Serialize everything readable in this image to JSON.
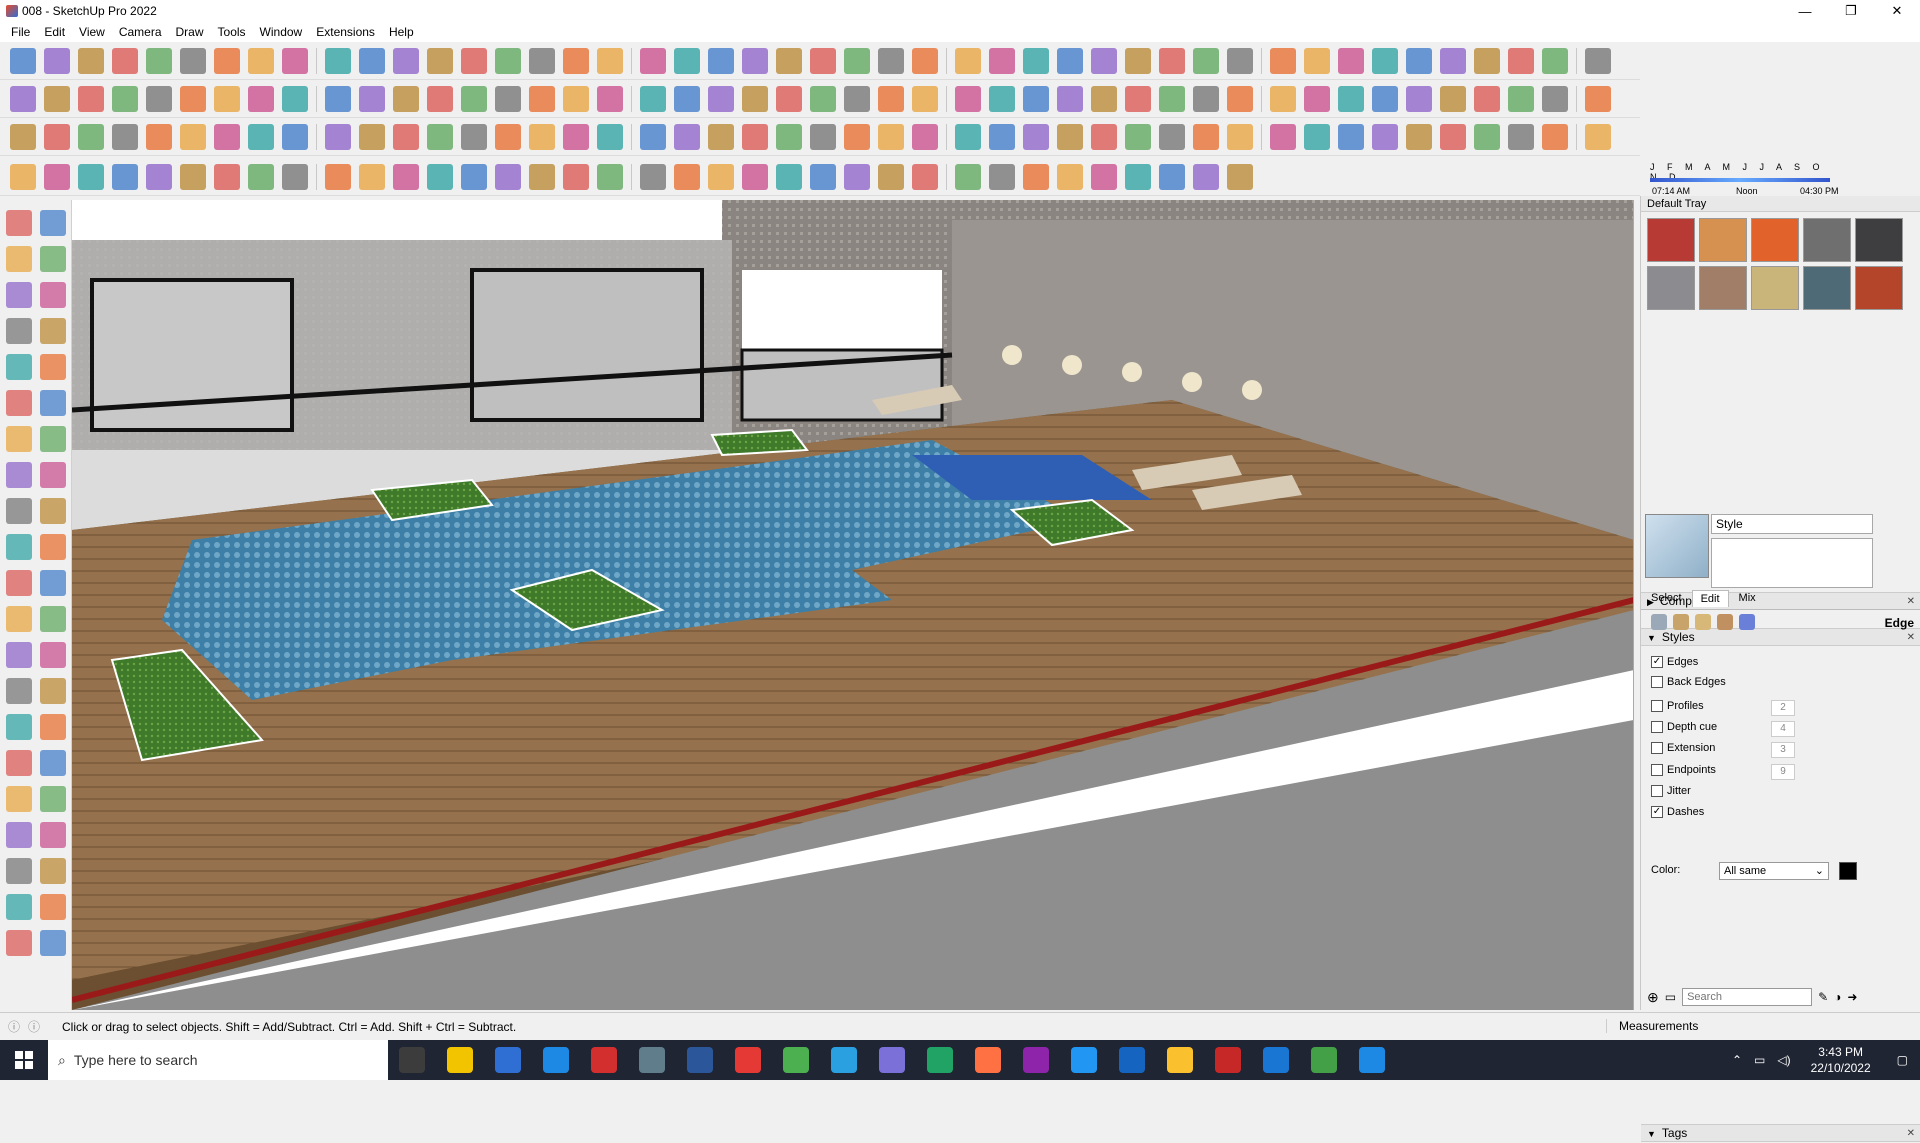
{
  "window": {
    "title": "008 - SketchUp Pro 2022",
    "minimize": "—",
    "maximize": "❐",
    "close": "✕"
  },
  "menu": [
    "File",
    "Edit",
    "View",
    "Camera",
    "Draw",
    "Tools",
    "Window",
    "Extensions",
    "Help"
  ],
  "shadow": {
    "months": "J F M A M J J A S O N D",
    "start_time": "07:14 AM",
    "mid_time": "Noon",
    "end_time": "04:30 PM"
  },
  "tray": {
    "title": "Default Tray",
    "swatch_colors": [
      "#b83a34",
      "#d6904f",
      "#e2622c",
      "#6f6f70",
      "#3e3e40",
      "#8c8c90",
      "#a07e68",
      "#c9b47a",
      "#4f6a77",
      "#b5452a"
    ],
    "components_label": "Components",
    "styles_label": "Styles",
    "style_name": "Style",
    "tabs": [
      "Select",
      "Edit",
      "Mix"
    ],
    "edge_label": "Edge",
    "edge_settings": [
      {
        "label": "Edges",
        "checked": true,
        "value": ""
      },
      {
        "label": "Back Edges",
        "checked": false,
        "value": ""
      },
      {
        "label": "Profiles",
        "checked": false,
        "value": "2"
      },
      {
        "label": "Depth cue",
        "checked": false,
        "value": "4"
      },
      {
        "label": "Extension",
        "checked": false,
        "value": "3"
      },
      {
        "label": "Endpoints",
        "checked": false,
        "value": "9"
      },
      {
        "label": "Jitter",
        "checked": false,
        "value": ""
      },
      {
        "label": "Dashes",
        "checked": true,
        "value": ""
      }
    ],
    "color_label": "Color:",
    "color_value": "All same",
    "color_swatch": "#000000",
    "tags_label": "Tags",
    "tags_search_placeholder": "Search"
  },
  "status": {
    "message": "Click or drag to select objects. Shift = Add/Subtract. Ctrl = Add. Shift + Ctrl = Subtract.",
    "measurements_label": "Measurements"
  },
  "taskbar": {
    "search_placeholder": "Type here to search",
    "time": "3:43 PM",
    "date": "22/10/2022"
  }
}
